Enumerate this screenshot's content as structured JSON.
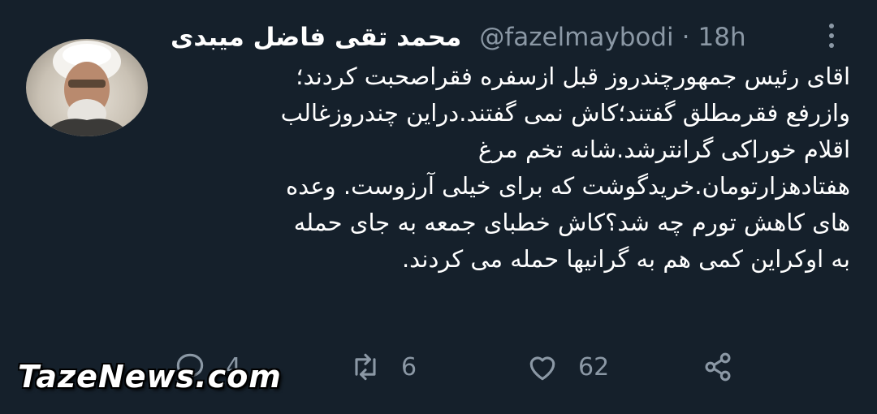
{
  "tweet": {
    "author_name": "محمد تقی فاضل میبدی",
    "handle": "@fazelmaybodi",
    "separator": "·",
    "time": "18h",
    "body_lines": [
      "اقای رئیس جمهورچندروز قبل ازسفره فقراصحبت کردند؛",
      "وازرفع فقرمطلق گفتند؛کاش نمی گفتند.دراین چندروزغالب",
      "اقلام خوراکی گرانترشد.شانه تخم مرغ",
      "هفتادهزارتومان.خریدگوشت که برای خیلی آرزوست. وعده",
      "های کاهش تورم چه شد؟کاش خطبای جمعه به جای حمله",
      "به اوکراین کمی هم به گرانیها حمله می کردند."
    ]
  },
  "actions": {
    "reply_count": "4",
    "retweet_count": "6",
    "like_count": "62"
  },
  "icons": {
    "reply": "reply-icon",
    "retweet": "retweet-icon",
    "like": "heart-icon",
    "share": "share-icon",
    "more": "more-vertical-icon"
  },
  "watermark": "TazeNews.com",
  "colors": {
    "background": "#15202b",
    "text": "#ffffff",
    "muted": "#8b98a5"
  }
}
